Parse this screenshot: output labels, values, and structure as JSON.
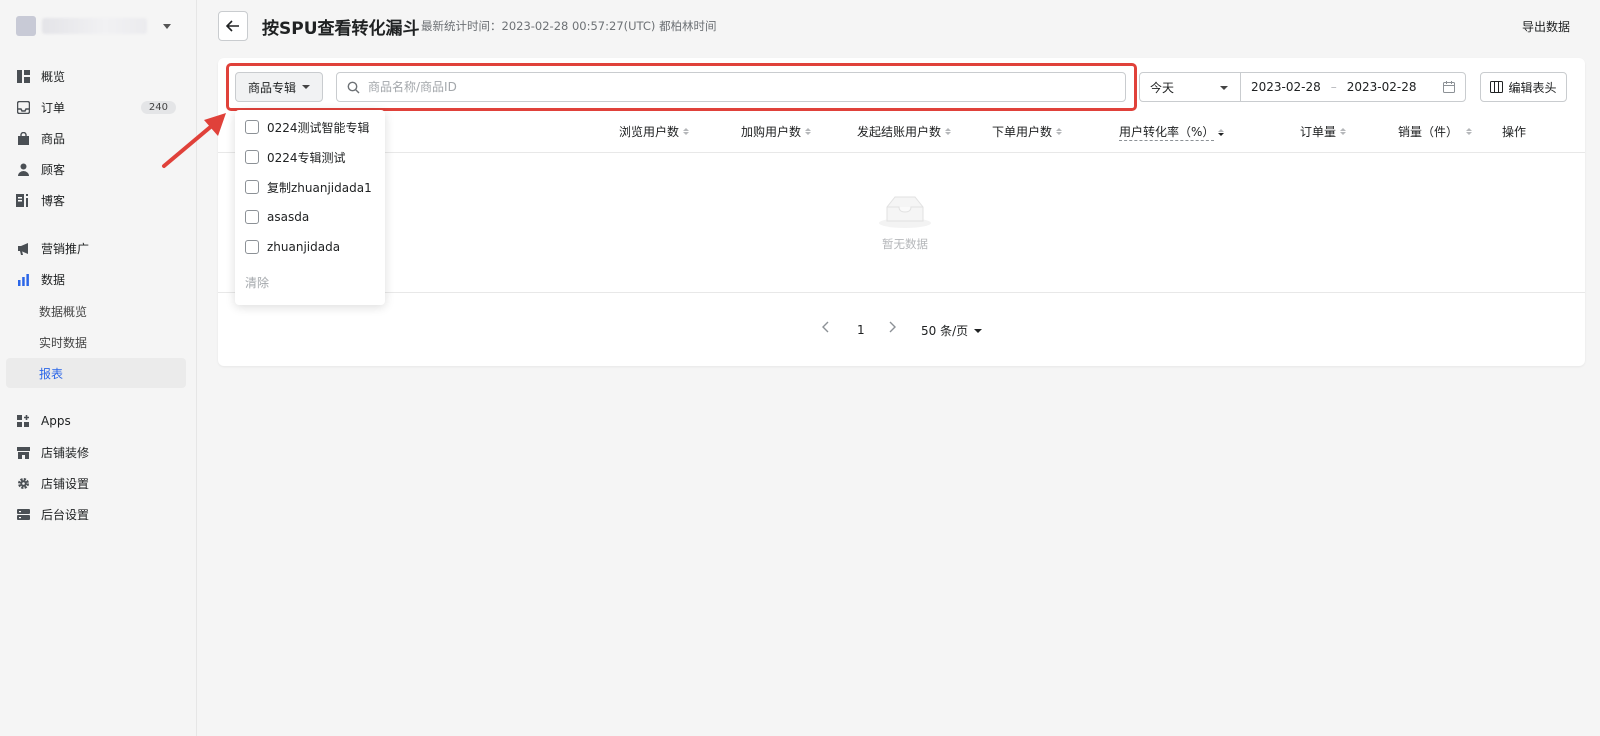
{
  "sidebar": {
    "nav": [
      {
        "label": "概览"
      },
      {
        "label": "订单",
        "badge": "240"
      },
      {
        "label": "商品"
      },
      {
        "label": "顾客"
      },
      {
        "label": "博客"
      },
      {
        "label": "营销推广"
      },
      {
        "label": "数据"
      },
      {
        "label": "Apps"
      },
      {
        "label": "店铺装修"
      },
      {
        "label": "店铺设置"
      },
      {
        "label": "后台设置"
      }
    ],
    "data_sub": [
      "数据概览",
      "实时数据",
      "报表"
    ]
  },
  "header": {
    "title": "按SPU查看转化漏斗",
    "meta": "最新统计时间：2023-02-28 00:57:27(UTC) 都柏林时间",
    "export": "导出数据"
  },
  "filters": {
    "collection_button": "商品专辑",
    "search_placeholder": "商品名称/商品ID",
    "range": "今天",
    "date_start": "2023-02-28",
    "date_end": "2023-02-28",
    "date_sep": "–",
    "edit_columns": "编辑表头"
  },
  "dropdown": {
    "options": [
      "0224测试智能专辑",
      "0224专辑测试",
      "复制zhuanjidada1",
      "asasda",
      "zhuanjidada"
    ],
    "clear": "清除"
  },
  "table": {
    "columns": [
      "浏览用户数",
      "加购用户数",
      "发起结账用户数",
      "下单用户数",
      "用户转化率（%）",
      "订单量",
      "销量（件）",
      "操作"
    ],
    "empty": "暂无数据"
  },
  "pagination": {
    "page": "1",
    "page_size": "50 条/页"
  },
  "colors": {
    "highlight": "#e0413a",
    "active_nav": "#2b66e8"
  }
}
